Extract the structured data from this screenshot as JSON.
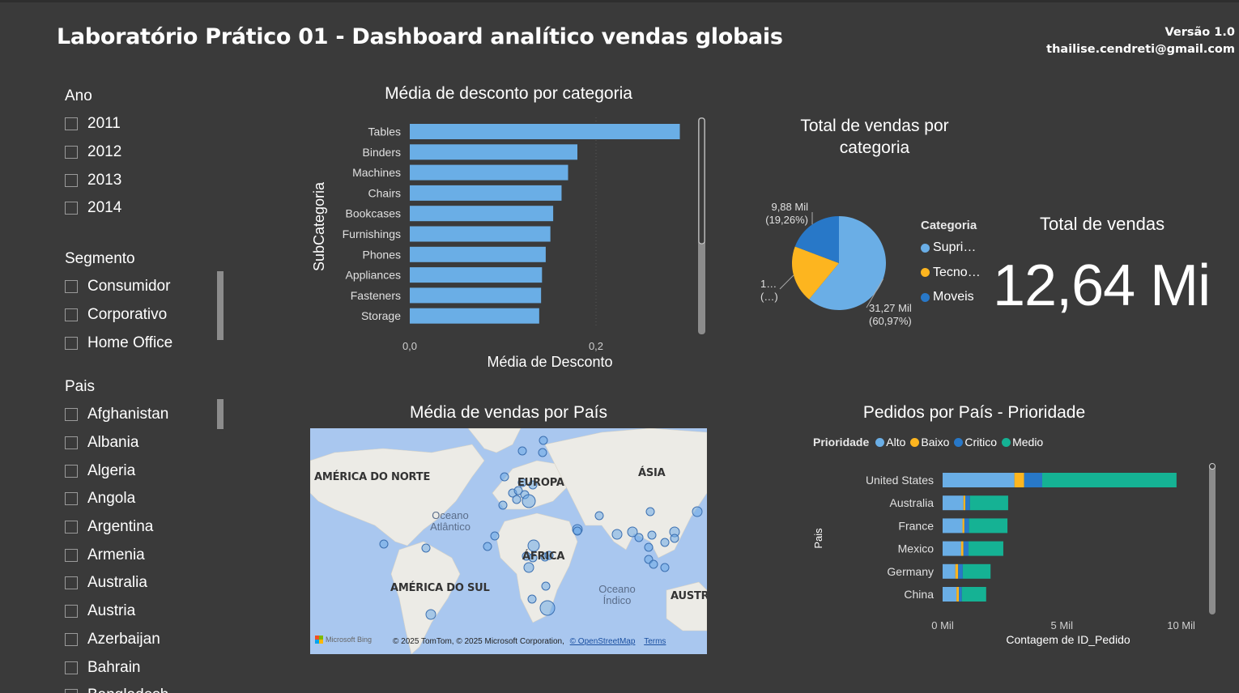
{
  "header": {
    "title": "Laboratório Prático 01 - Dashboard analítico vendas globais",
    "version": "Versão 1.0",
    "email": "thailise.cendreti@gmail.com"
  },
  "slicers": {
    "ano": {
      "title": "Ano",
      "items": [
        "2011",
        "2012",
        "2013",
        "2014"
      ]
    },
    "segmento": {
      "title": "Segmento",
      "items": [
        "Consumidor",
        "Corporativo",
        "Home Office"
      ]
    },
    "pais": {
      "title": "Pais",
      "items": [
        "Afghanistan",
        "Albania",
        "Algeria",
        "Angola",
        "Argentina",
        "Armenia",
        "Australia",
        "Austria",
        "Azerbaijan",
        "Bahrain",
        "Bangladesh"
      ]
    }
  },
  "colors": {
    "background": "#3a3a3a",
    "bar_blue": "#6aaee6",
    "yellow": "#fdb51f",
    "dark_blue": "#2878c8",
    "teal": "#15b294"
  },
  "chart_data": [
    {
      "type": "bar",
      "orientation": "horizontal",
      "title": "Média de desconto por categoria",
      "xlabel": "Média de Desconto",
      "ylabel": "SubCategoria",
      "categories": [
        "Tables",
        "Binders",
        "Machines",
        "Chairs",
        "Bookcases",
        "Furnishings",
        "Phones",
        "Appliances",
        "Fasteners",
        "Storage"
      ],
      "values": [
        0.29,
        0.18,
        0.17,
        0.163,
        0.154,
        0.151,
        0.146,
        0.142,
        0.141,
        0.139
      ],
      "xlim": [
        0,
        0.3
      ],
      "ticks": [
        "0,0",
        "0,2"
      ]
    },
    {
      "type": "pie",
      "title": "Total de vendas por categoria",
      "legend_title": "Categoria",
      "legend": [
        "Supri…",
        "Tecno…",
        "Moveis"
      ],
      "slices": [
        {
          "name": "Supri…",
          "value": 60.97,
          "label": "31,27 Mil",
          "pct": "(60,97%)"
        },
        {
          "name": "Tecno…",
          "value": 19.77,
          "label": "1…",
          "pct": "(…)"
        },
        {
          "name": "Moveis",
          "value": 19.26,
          "label": "9,88 Mil",
          "pct": "(19,26%)"
        }
      ]
    },
    {
      "type": "scatter",
      "title": "Média de vendas por País",
      "map_labels": [
        "AMÉRICA DO NORTE",
        "EUROPA",
        "ÁSIA",
        "ÁFRICA",
        "AMÉRICA DO SUL",
        "AUSTR"
      ],
      "ocean_labels": [
        "Oceano Atlântico",
        "Oceano Índico"
      ],
      "attribution": "© 2025 TomTom, © 2025 Microsoft Corporation,",
      "attribution_link": "© OpenStreetMap",
      "terms": "Terms",
      "bing": "Microsoft Bing"
    },
    {
      "type": "bar",
      "stacked": true,
      "orientation": "horizontal",
      "title": "Pedidos por País - Prioridade",
      "legend_title": "Prioridade",
      "xlabel": "Contagem de ID_Pedido",
      "ylabel": "Pais",
      "categories": [
        "United States",
        "Australia",
        "France",
        "Mexico",
        "Germany",
        "China"
      ],
      "series": [
        {
          "name": "Alto",
          "values": [
            3.1,
            0.9,
            0.86,
            0.8,
            0.55,
            0.6
          ]
        },
        {
          "name": "Baixo",
          "values": [
            0.42,
            0.08,
            0.08,
            0.1,
            0.12,
            0.1
          ]
        },
        {
          "name": "Critico",
          "values": [
            0.78,
            0.2,
            0.2,
            0.22,
            0.2,
            0.13
          ]
        },
        {
          "name": "Medio",
          "values": [
            5.8,
            1.65,
            1.66,
            1.5,
            1.2,
            1.05
          ]
        }
      ],
      "xlim": [
        0,
        10.5
      ],
      "ticks": [
        "0 Mil",
        "5 Mil",
        "10 Mil"
      ]
    }
  ],
  "kpi": {
    "label": "Total de vendas",
    "value": "12,64 Mi"
  }
}
